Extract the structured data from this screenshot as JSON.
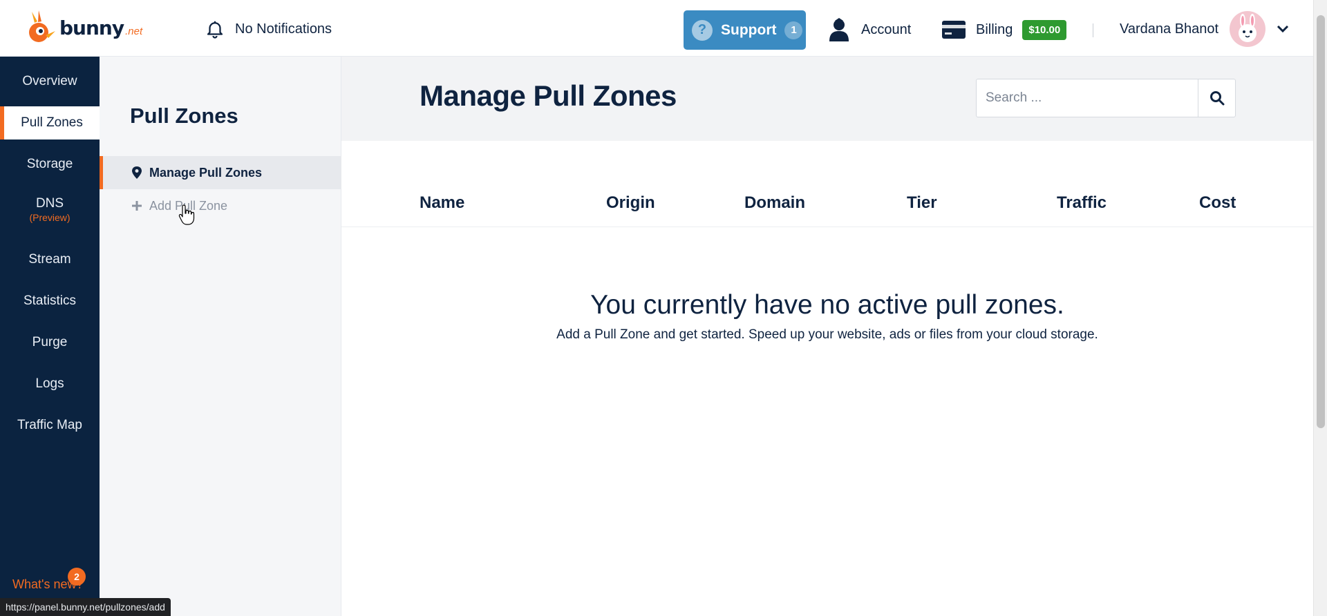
{
  "brand": {
    "logo_text": "bunny",
    "logo_tld": ".net",
    "accent": "#f26b21",
    "navy": "#0b2340"
  },
  "topbar": {
    "notifications_label": "No Notifications",
    "support_label": "Support",
    "support_count": "1",
    "account_label": "Account",
    "billing_label": "Billing",
    "billing_balance": "$10.00",
    "user_name": "Vardana Bhanot"
  },
  "leftnav": {
    "items": [
      {
        "label": "Overview",
        "sub": ""
      },
      {
        "label": "Pull Zones",
        "sub": ""
      },
      {
        "label": "Storage",
        "sub": ""
      },
      {
        "label": "DNS",
        "sub": "(Preview)"
      },
      {
        "label": "Stream",
        "sub": ""
      },
      {
        "label": "Statistics",
        "sub": ""
      },
      {
        "label": "Purge",
        "sub": ""
      },
      {
        "label": "Logs",
        "sub": ""
      },
      {
        "label": "Traffic Map",
        "sub": ""
      }
    ],
    "active": "Pull Zones",
    "whats_new_label": "What's new?",
    "whats_new_count": "2"
  },
  "subnav": {
    "title": "Pull Zones",
    "items": [
      {
        "label": "Manage Pull Zones",
        "icon": "map-pin-icon"
      },
      {
        "label": "Add Pull Zone",
        "icon": "plus-icon"
      }
    ]
  },
  "main": {
    "title": "Manage Pull Zones",
    "search_placeholder": "Search ...",
    "columns": [
      "Name",
      "Origin",
      "Domain",
      "Tier",
      "Traffic",
      "Cost"
    ],
    "empty_title": "You currently have no active pull zones.",
    "empty_description": "Add a Pull Zone and get started. Speed up your website, ads or files from your cloud storage."
  },
  "statusbar": {
    "url": "https://panel.bunny.net/pullzones/add"
  }
}
